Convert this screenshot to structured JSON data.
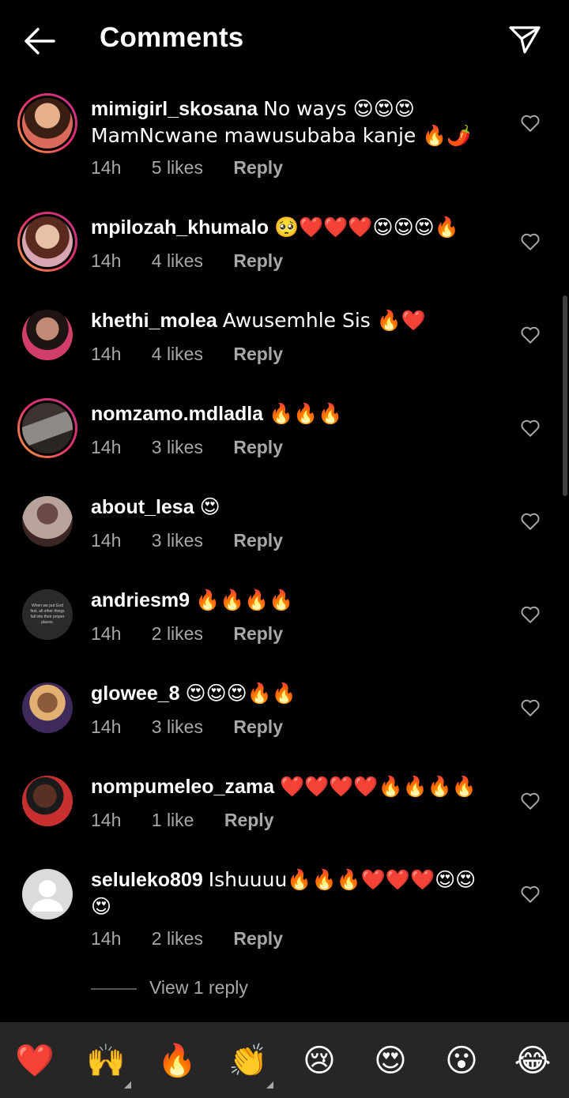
{
  "header": {
    "title": "Comments",
    "back_icon": "arrow-left-icon",
    "share_icon": "paper-plane-icon"
  },
  "comments": [
    {
      "username": "mimigirl_skosana",
      "text": "No ways 😍😍😍 MamNcwane mawusubaba kanje 🔥🌶️",
      "time": "14h",
      "likes": "5 likes",
      "reply": "Reply",
      "avatar_color": "#c98a5e"
    },
    {
      "username": "mpilozah_khumalo",
      "text": "🥺❤️❤️❤️😍😍😍🔥",
      "time": "14h",
      "likes": "4 likes",
      "reply": "Reply",
      "avatar_color": "#b07a6a"
    },
    {
      "username": "khethi_molea",
      "text": "Awusemhle Sis 🔥❤️",
      "time": "14h",
      "likes": "4 likes",
      "reply": "Reply",
      "avatar_color": "#6a3d4e"
    },
    {
      "username": "nomzamo.mdladla",
      "text": "🔥🔥🔥",
      "time": "14h",
      "likes": "3 likes",
      "reply": "Reply",
      "avatar_color": "#7d7a78"
    },
    {
      "username": "about_lesa",
      "text": "😍",
      "time": "14h",
      "likes": "3 likes",
      "reply": "Reply",
      "avatar_color": "#5a3e3a"
    },
    {
      "username": "andriesm9",
      "text": "🔥🔥🔥🔥",
      "time": "14h",
      "likes": "2 likes",
      "reply": "Reply",
      "avatar_color": "#2a2a2a"
    },
    {
      "username": "glowee_8",
      "text": "😍😍😍🔥🔥",
      "time": "14h",
      "likes": "3 likes",
      "reply": "Reply",
      "avatar_color": "#8a5a3a"
    },
    {
      "username": "nompumeleo_zama",
      "text": "❤️❤️❤️❤️🔥🔥🔥🔥",
      "time": "14h",
      "likes": "1 like",
      "reply": "Reply",
      "avatar_color": "#a23030"
    },
    {
      "username": "seluleko809",
      "text": "Ishuuuu🔥🔥🔥❤️❤️❤️😍😍😍",
      "time": "14h",
      "likes": "2 likes",
      "reply": "Reply",
      "avatar_color": "#d8d8d8"
    }
  ],
  "avatar6_text": "When we put God first, all other things fall into their proper places.",
  "view_replies": "View 1 reply",
  "reactions": [
    "❤️",
    "🙌",
    "🔥",
    "👏",
    "😢",
    "😍",
    "😮",
    "😂"
  ],
  "colors": {
    "background": "#000000",
    "secondary_text": "#a8a8a8",
    "reaction_bar": "#262626",
    "story_ring": "#e1306c"
  }
}
